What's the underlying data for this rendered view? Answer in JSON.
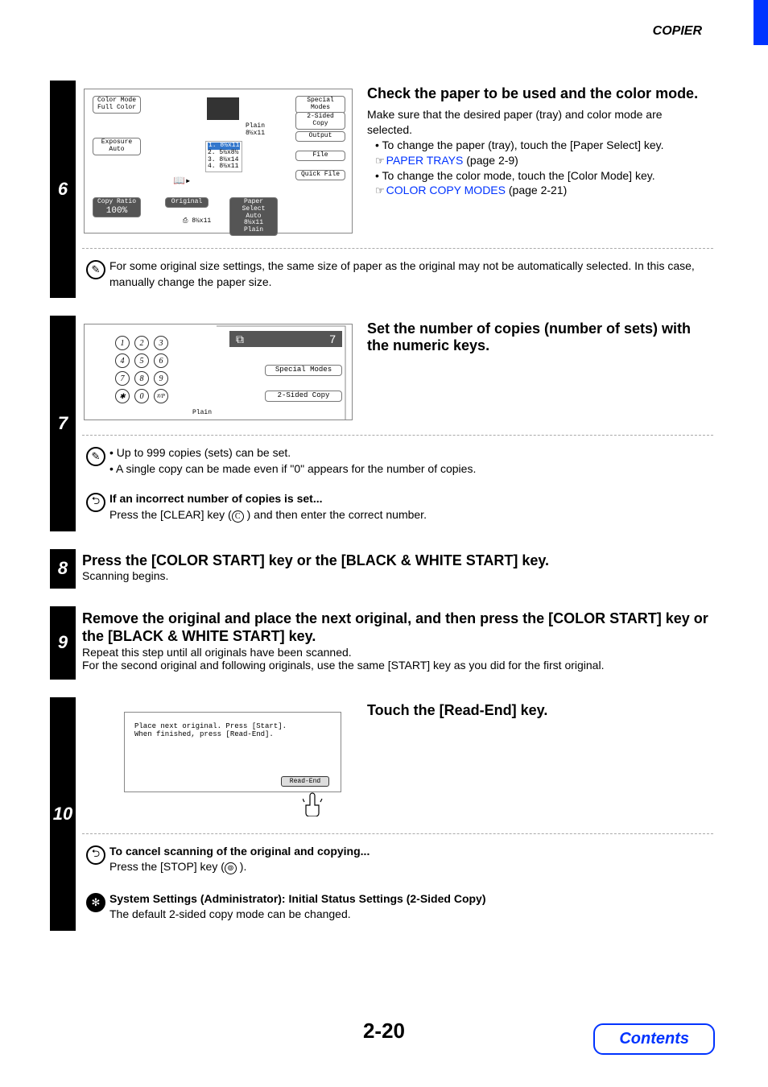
{
  "header": {
    "section": "COPIER"
  },
  "steps": {
    "s6": {
      "num": "6",
      "title": "Check the paper to be used and the color mode.",
      "intro": "Make sure that the desired paper (tray) and color mode are selected.",
      "b1": "To change the paper (tray), touch the [Paper Select] key.",
      "link1_pre": "☞ ",
      "link1": "PAPER TRAYS",
      "link1_post": " (page 2-9)",
      "b2": "To change the color mode, touch the [Color Mode] key.",
      "link2_pre": "☞ ",
      "link2": "COLOR COPY MODES",
      "link2_post": " (page 2-21)",
      "note": "For some original size settings, the same size of paper as the original may not be automatically selected. In this case, manually change the paper size.",
      "panel": {
        "colorMode": "Color Mode",
        "fullColor": "Full Color",
        "exposure": "Exposure",
        "auto": "Auto",
        "copyRatio": "Copy Ratio",
        "ratio": "100%",
        "original": "Original",
        "paperSelect": "Paper Select",
        "psLine1": "Auto",
        "psLine2": "8½x11",
        "psLine3": "Plain",
        "special": "Special Modes",
        "twoSided": "2-Sided Copy",
        "output": "Output",
        "file": "File",
        "quickFile": "Quick File",
        "plain": "Plain",
        "tray1": "1. 8½x11",
        "tray2": "2. 5½x8½",
        "tray3": "3. 8½x14",
        "tray4": "4. 8½x11",
        "mediaSize": "8½x11",
        "autoImg": "8½x11"
      }
    },
    "s7": {
      "num": "7",
      "title": "Set the number of copies (number of sets) with the numeric keys.",
      "panel": {
        "display": "7",
        "special": "Special Modes",
        "twoSided": "2-Sided Copy",
        "plain": "Plain",
        "k1": "1",
        "k2": "2",
        "k3": "3",
        "k4": "4",
        "k5": "5",
        "k6": "6",
        "k7": "7",
        "k8": "8",
        "k9": "9",
        "ks": "✱",
        "k0": "0",
        "kh": "#/P"
      },
      "note1": "Up to 999 copies (sets) can be set.",
      "note2": "A single copy can be made even if \"0\" appears for the number of copies.",
      "tipTitle": "If an incorrect number of copies is set...",
      "tipText1": "Press the [CLEAR] key (",
      "tipKey": "C",
      "tipText2": " ) and then enter the correct number."
    },
    "s8": {
      "num": "8",
      "title": "Press the [COLOR START] key or the [BLACK & WHITE START] key.",
      "text": "Scanning begins."
    },
    "s9": {
      "num": "9",
      "title": "Remove the original and place the next original, and then press the [COLOR START] key or the [BLACK & WHITE START] key.",
      "l1": "Repeat this step until all originals have been scanned.",
      "l2": "For the second original and following originals, use the same [START] key as you did for the first original."
    },
    "s10": {
      "num": "10",
      "title": "Touch the [Read-End] key.",
      "panel": {
        "line1": "Place next original. Press [Start].",
        "line2": "When finished, press [Read-End].",
        "button": "Read-End"
      },
      "tipTitle": "To cancel scanning of the original and copying...",
      "tipText1": "Press the [STOP] key (",
      "tipKey": "⊚",
      "tipText2": " ).",
      "adminTitle": "System Settings (Administrator): Initial Status Settings (2-Sided Copy)",
      "adminText": "The default 2-sided copy mode can be changed."
    }
  },
  "footer": {
    "page": "2-20",
    "contents": "Contents"
  }
}
